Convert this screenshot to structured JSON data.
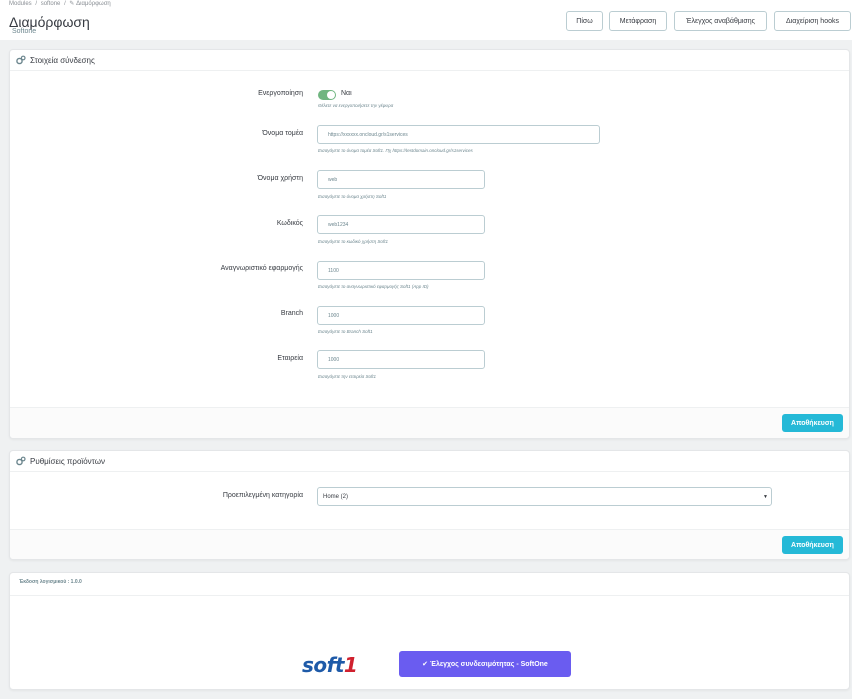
{
  "breadcrumb": [
    "Modules",
    "/",
    "softone",
    "/",
    "✎ Διαμόρφωση"
  ],
  "header": {
    "title": "Διαμόρφωση",
    "subtitle": "Softone"
  },
  "toolbar": {
    "back": "Πίσω",
    "translate": "Μετάφραση",
    "update_check": "Έλεγχος αναβάθμισης",
    "hooks": "Διαχείριση hooks"
  },
  "connection_panel": {
    "title": "Στοιχεία σύνδεσης",
    "enable": {
      "label": "Ενεργοποίηση",
      "toggle_text": "Ναι",
      "help": "Θέλετε να ενεργοποιήσετε την γέφυρα",
      "state": true
    },
    "domain": {
      "label": "Όνομα τομέα",
      "value": "https://xxxxxx.oncloud.gr/s1services",
      "help": "Εισαγάγετε το όνομα τομέα Soft1. Πχ https://testdomain.oncloud.gr/s1services"
    },
    "username": {
      "label": "Όνομα χρήστη",
      "value": "web",
      "help": "Εισαγάγετε το όνομα χρήστη Soft1"
    },
    "password": {
      "label": "Κωδικός",
      "value": "web1234",
      "help": "Εισαγάγετε το κωδικό χρήστη Soft1"
    },
    "app_id": {
      "label": "Αναγνωριστικό εφαρμογής",
      "value": "1100",
      "help": "Εισαγάγετε το αναγνωριστικό εφαρμογής Soft1 (App ID)"
    },
    "branch": {
      "label": "Branch",
      "value": "1000",
      "help": "Εισαγάγετε το Branch Soft1"
    },
    "company": {
      "label": "Εταιρεία",
      "value": "1000",
      "help": "Εισαγάγετε την εταιρεία Soft1"
    },
    "save": "Αποθήκευση"
  },
  "product_panel": {
    "title": "Ρυθμίσεις προϊόντων",
    "category": {
      "label": "Προεπιλεγμένη κατηγορία",
      "value": "Home (2)"
    },
    "save": "Αποθήκευση"
  },
  "footer_panel": {
    "version": "Έκδοση λογισμικού : 1.0.0",
    "logo_text_1": "soft",
    "logo_text_2": "1",
    "check_button": "✔ Έλεγχος συνδεσιμότητας - SoftOne"
  },
  "colors": {
    "accent": "#25b9d7",
    "toggle_on": "#70b580",
    "check_button": "#6a5cf0",
    "logo_blue": "#1e5aa8",
    "logo_red": "#d0202e"
  }
}
